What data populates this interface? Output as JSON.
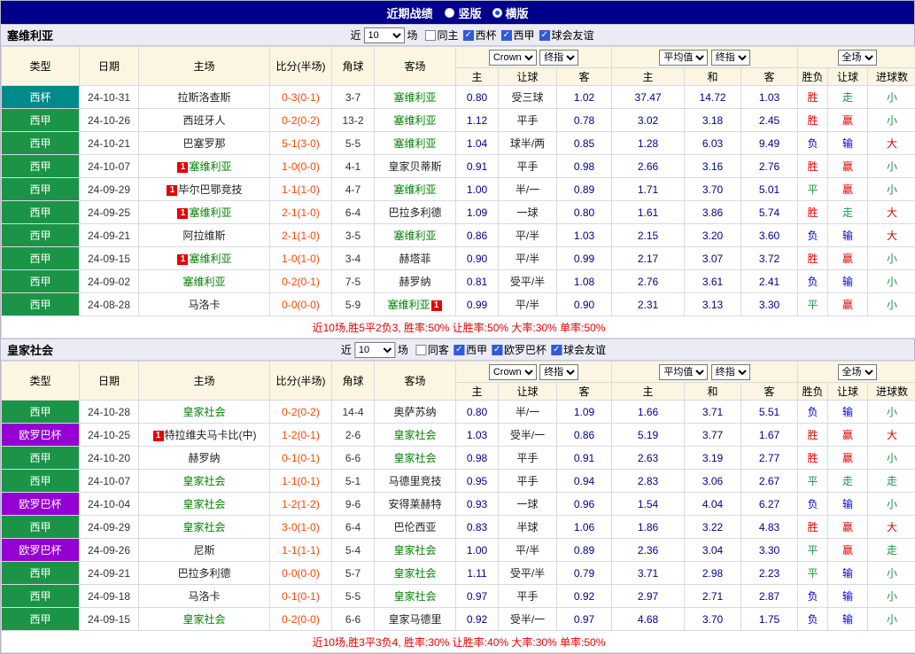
{
  "topbar": {
    "title": "近期战绩",
    "radios": [
      {
        "label": "竖版",
        "checked": false
      },
      {
        "label": "横版",
        "checked": true
      }
    ]
  },
  "colors": {
    "league": {
      "西甲": "#1B9447",
      "西杯": "#008B8B",
      "欧罗巴杯": "#9400D3"
    },
    "accent_navy": "#00008B",
    "result_red": "#E60000",
    "result_blue": "#0000DD",
    "result_green": "#1B9447",
    "team_green": "#008000",
    "score_orange": "#FF4400"
  },
  "table_header": {
    "type": "类型",
    "date": "日期",
    "home": "主场",
    "score": "比分(半场)",
    "corner": "角球",
    "away": "客场",
    "odds_group": {
      "select1": "Crown",
      "select2": "终指",
      "sub": [
        "主",
        "让球",
        "客"
      ]
    },
    "avg_group": {
      "select1": "平均值",
      "select2": "终指",
      "sub": [
        "主",
        "和",
        "客"
      ]
    },
    "scope_group": {
      "select1": "全场",
      "sub": [
        "胜负",
        "让球",
        "进球数"
      ]
    }
  },
  "sections": [
    {
      "team": "塞维利亚",
      "filter": {
        "prefix": "近",
        "count": "10",
        "suffix": "场",
        "checkboxes": [
          {
            "label": "同主",
            "checked": false
          },
          {
            "label": "西杯",
            "checked": true
          },
          {
            "label": "西甲",
            "checked": true
          },
          {
            "label": "球会友谊",
            "checked": true
          }
        ]
      },
      "rows": [
        {
          "league": "西杯",
          "date": "24-10-31",
          "home": {
            "name": "拉斯洛查斯",
            "team": false
          },
          "score": "0-3(0-1)",
          "corner": "3-7",
          "away": {
            "name": "塞维利亚",
            "team": true
          },
          "odds": [
            "0.80",
            "受三球",
            "1.02"
          ],
          "avg": [
            "37.47",
            "14.72",
            "1.03"
          ],
          "results": [
            [
              "胜",
              "red"
            ],
            [
              "走",
              "green"
            ],
            [
              "小",
              "green"
            ]
          ]
        },
        {
          "league": "西甲",
          "date": "24-10-26",
          "home": {
            "name": "西班牙人",
            "team": false
          },
          "score": "0-2(0-2)",
          "corner": "13-2",
          "away": {
            "name": "塞维利亚",
            "team": true
          },
          "odds": [
            "1.12",
            "平手",
            "0.78"
          ],
          "avg": [
            "3.02",
            "3.18",
            "2.45"
          ],
          "results": [
            [
              "胜",
              "red"
            ],
            [
              "赢",
              "red"
            ],
            [
              "小",
              "green"
            ]
          ]
        },
        {
          "league": "西甲",
          "date": "24-10-21",
          "home": {
            "name": "巴塞罗那",
            "team": false
          },
          "score": "5-1(3-0)",
          "corner": "5-5",
          "away": {
            "name": "塞维利亚",
            "team": true
          },
          "odds": [
            "1.04",
            "球半/两",
            "0.85"
          ],
          "avg": [
            "1.28",
            "6.03",
            "9.49"
          ],
          "results": [
            [
              "负",
              "blue"
            ],
            [
              "输",
              "blue"
            ],
            [
              "大",
              "red"
            ]
          ]
        },
        {
          "league": "西甲",
          "date": "24-10-07",
          "home": {
            "name": "塞维利亚",
            "team": true,
            "badge": "1",
            "badge_pos": "before"
          },
          "score": "1-0(0-0)",
          "corner": "4-1",
          "away": {
            "name": "皇家贝蒂斯",
            "team": false
          },
          "odds": [
            "0.91",
            "平手",
            "0.98"
          ],
          "avg": [
            "2.66",
            "3.16",
            "2.76"
          ],
          "results": [
            [
              "胜",
              "red"
            ],
            [
              "赢",
              "red"
            ],
            [
              "小",
              "green"
            ]
          ]
        },
        {
          "league": "西甲",
          "date": "24-09-29",
          "home": {
            "name": "毕尔巴鄂竞技",
            "team": false,
            "badge": "1",
            "badge_pos": "before"
          },
          "score": "1-1(1-0)",
          "corner": "4-7",
          "away": {
            "name": "塞维利亚",
            "team": true
          },
          "odds": [
            "1.00",
            "半/一",
            "0.89"
          ],
          "avg": [
            "1.71",
            "3.70",
            "5.01"
          ],
          "results": [
            [
              "平",
              "green"
            ],
            [
              "赢",
              "red"
            ],
            [
              "小",
              "green"
            ]
          ]
        },
        {
          "league": "西甲",
          "date": "24-09-25",
          "home": {
            "name": "塞维利亚",
            "team": true,
            "badge": "1",
            "badge_pos": "before"
          },
          "score": "2-1(1-0)",
          "corner": "6-4",
          "away": {
            "name": "巴拉多利德",
            "team": false
          },
          "odds": [
            "1.09",
            "一球",
            "0.80"
          ],
          "avg": [
            "1.61",
            "3.86",
            "5.74"
          ],
          "results": [
            [
              "胜",
              "red"
            ],
            [
              "走",
              "green"
            ],
            [
              "大",
              "red"
            ]
          ]
        },
        {
          "league": "西甲",
          "date": "24-09-21",
          "home": {
            "name": "阿拉维斯",
            "team": false
          },
          "score": "2-1(1-0)",
          "corner": "3-5",
          "away": {
            "name": "塞维利亚",
            "team": true
          },
          "odds": [
            "0.86",
            "平/半",
            "1.03"
          ],
          "avg": [
            "2.15",
            "3.20",
            "3.60"
          ],
          "results": [
            [
              "负",
              "blue"
            ],
            [
              "输",
              "blue"
            ],
            [
              "大",
              "red"
            ]
          ]
        },
        {
          "league": "西甲",
          "date": "24-09-15",
          "home": {
            "name": "塞维利亚",
            "team": true,
            "badge": "1",
            "badge_pos": "before"
          },
          "score": "1-0(1-0)",
          "corner": "3-4",
          "away": {
            "name": "赫塔菲",
            "team": false
          },
          "odds": [
            "0.90",
            "平/半",
            "0.99"
          ],
          "avg": [
            "2.17",
            "3.07",
            "3.72"
          ],
          "results": [
            [
              "胜",
              "red"
            ],
            [
              "赢",
              "red"
            ],
            [
              "小",
              "green"
            ]
          ]
        },
        {
          "league": "西甲",
          "date": "24-09-02",
          "home": {
            "name": "塞维利亚",
            "team": true
          },
          "score": "0-2(0-1)",
          "corner": "7-5",
          "away": {
            "name": "赫罗纳",
            "team": false
          },
          "odds": [
            "0.81",
            "受平/半",
            "1.08"
          ],
          "avg": [
            "2.76",
            "3.61",
            "2.41"
          ],
          "results": [
            [
              "负",
              "blue"
            ],
            [
              "输",
              "blue"
            ],
            [
              "小",
              "green"
            ]
          ]
        },
        {
          "league": "西甲",
          "date": "24-08-28",
          "home": {
            "name": "马洛卡",
            "team": false
          },
          "score": "0-0(0-0)",
          "corner": "5-9",
          "away": {
            "name": "塞维利亚",
            "team": true,
            "badge": "1",
            "badge_pos": "after"
          },
          "odds": [
            "0.99",
            "平/半",
            "0.90"
          ],
          "avg": [
            "2.31",
            "3.13",
            "3.30"
          ],
          "results": [
            [
              "平",
              "green"
            ],
            [
              "赢",
              "red"
            ],
            [
              "小",
              "green"
            ]
          ]
        }
      ],
      "summary": "近10场,胜5平2负3, 胜率:50% 让胜率:50% 大率:30% 单率:50%"
    },
    {
      "team": "皇家社会",
      "filter": {
        "prefix": "近",
        "count": "10",
        "suffix": "场",
        "checkboxes": [
          {
            "label": "同客",
            "checked": false
          },
          {
            "label": "西甲",
            "checked": true
          },
          {
            "label": "欧罗巴杯",
            "checked": true
          },
          {
            "label": "球会友谊",
            "checked": true
          }
        ]
      },
      "rows": [
        {
          "league": "西甲",
          "date": "24-10-28",
          "home": {
            "name": "皇家社会",
            "team": true
          },
          "score": "0-2(0-2)",
          "corner": "14-4",
          "away": {
            "name": "奥萨苏纳",
            "team": false
          },
          "odds": [
            "0.80",
            "半/一",
            "1.09"
          ],
          "avg": [
            "1.66",
            "3.71",
            "5.51"
          ],
          "results": [
            [
              "负",
              "blue"
            ],
            [
              "输",
              "blue"
            ],
            [
              "小",
              "green"
            ]
          ]
        },
        {
          "league": "欧罗巴杯",
          "date": "24-10-25",
          "home": {
            "name": "特拉维夫马卡比(中)",
            "team": false,
            "badge": "1",
            "badge_pos": "before"
          },
          "score": "1-2(0-1)",
          "corner": "2-6",
          "away": {
            "name": "皇家社会",
            "team": true
          },
          "odds": [
            "1.03",
            "受半/一",
            "0.86"
          ],
          "avg": [
            "5.19",
            "3.77",
            "1.67"
          ],
          "results": [
            [
              "胜",
              "red"
            ],
            [
              "赢",
              "red"
            ],
            [
              "大",
              "red"
            ]
          ]
        },
        {
          "league": "西甲",
          "date": "24-10-20",
          "home": {
            "name": "赫罗纳",
            "team": false
          },
          "score": "0-1(0-1)",
          "corner": "6-6",
          "away": {
            "name": "皇家社会",
            "team": true
          },
          "odds": [
            "0.98",
            "平手",
            "0.91"
          ],
          "avg": [
            "2.63",
            "3.19",
            "2.77"
          ],
          "results": [
            [
              "胜",
              "red"
            ],
            [
              "赢",
              "red"
            ],
            [
              "小",
              "green"
            ]
          ]
        },
        {
          "league": "西甲",
          "date": "24-10-07",
          "home": {
            "name": "皇家社会",
            "team": true
          },
          "score": "1-1(0-1)",
          "corner": "5-1",
          "away": {
            "name": "马德里竞技",
            "team": false
          },
          "odds": [
            "0.95",
            "平手",
            "0.94"
          ],
          "avg": [
            "2.83",
            "3.06",
            "2.67"
          ],
          "results": [
            [
              "平",
              "green"
            ],
            [
              "走",
              "green"
            ],
            [
              "走",
              "green"
            ]
          ]
        },
        {
          "league": "欧罗巴杯",
          "date": "24-10-04",
          "home": {
            "name": "皇家社会",
            "team": true
          },
          "score": "1-2(1-2)",
          "corner": "9-6",
          "away": {
            "name": "安得莱赫特",
            "team": false
          },
          "odds": [
            "0.93",
            "一球",
            "0.96"
          ],
          "avg": [
            "1.54",
            "4.04",
            "6.27"
          ],
          "results": [
            [
              "负",
              "blue"
            ],
            [
              "输",
              "blue"
            ],
            [
              "小",
              "green"
            ]
          ]
        },
        {
          "league": "西甲",
          "date": "24-09-29",
          "home": {
            "name": "皇家社会",
            "team": true
          },
          "score": "3-0(1-0)",
          "corner": "6-4",
          "away": {
            "name": "巴伦西亚",
            "team": false
          },
          "odds": [
            "0.83",
            "半球",
            "1.06"
          ],
          "avg": [
            "1.86",
            "3.22",
            "4.83"
          ],
          "results": [
            [
              "胜",
              "red"
            ],
            [
              "赢",
              "red"
            ],
            [
              "大",
              "red"
            ]
          ]
        },
        {
          "league": "欧罗巴杯",
          "date": "24-09-26",
          "home": {
            "name": "尼斯",
            "team": false
          },
          "score": "1-1(1-1)",
          "corner": "5-4",
          "away": {
            "name": "皇家社会",
            "team": true
          },
          "odds": [
            "1.00",
            "平/半",
            "0.89"
          ],
          "avg": [
            "2.36",
            "3.04",
            "3.30"
          ],
          "results": [
            [
              "平",
              "green"
            ],
            [
              "赢",
              "red"
            ],
            [
              "走",
              "green"
            ]
          ]
        },
        {
          "league": "西甲",
          "date": "24-09-21",
          "home": {
            "name": "巴拉多利德",
            "team": false
          },
          "score": "0-0(0-0)",
          "corner": "5-7",
          "away": {
            "name": "皇家社会",
            "team": true
          },
          "odds": [
            "1.11",
            "受平/半",
            "0.79"
          ],
          "avg": [
            "3.71",
            "2.98",
            "2.23"
          ],
          "results": [
            [
              "平",
              "green"
            ],
            [
              "输",
              "blue"
            ],
            [
              "小",
              "green"
            ]
          ]
        },
        {
          "league": "西甲",
          "date": "24-09-18",
          "home": {
            "name": "马洛卡",
            "team": false
          },
          "score": "0-1(0-1)",
          "corner": "5-5",
          "away": {
            "name": "皇家社会",
            "team": true
          },
          "odds": [
            "0.97",
            "平手",
            "0.92"
          ],
          "avg": [
            "2.97",
            "2.71",
            "2.87"
          ],
          "results": [
            [
              "负",
              "blue"
            ],
            [
              "输",
              "blue"
            ],
            [
              "小",
              "green"
            ]
          ]
        },
        {
          "league": "西甲",
          "date": "24-09-15",
          "home": {
            "name": "皇家社会",
            "team": true
          },
          "score": "0-2(0-0)",
          "corner": "6-6",
          "away": {
            "name": "皇家马德里",
            "team": false
          },
          "odds": [
            "0.92",
            "受半/一",
            "0.97"
          ],
          "avg": [
            "4.68",
            "3.70",
            "1.75"
          ],
          "results": [
            [
              "负",
              "blue"
            ],
            [
              "输",
              "blue"
            ],
            [
              "小",
              "green"
            ]
          ]
        }
      ],
      "summary": "近10场,胜3平3负4, 胜率:30% 让胜率:40% 大率:30% 单率:50%"
    }
  ]
}
